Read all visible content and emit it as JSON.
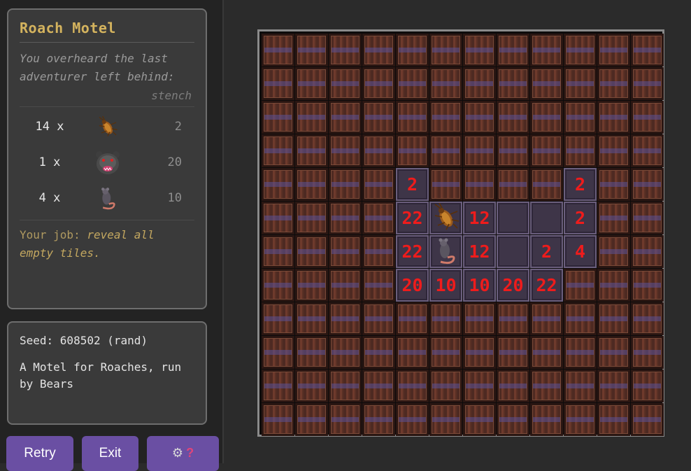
{
  "sidebar": {
    "title": "Roach Motel",
    "intro": "You overheard the last adventurer left behind:",
    "stench_header": "stench",
    "monsters": [
      {
        "count": "14 x",
        "icon": "roach-icon",
        "stench": "2"
      },
      {
        "count": "1 x",
        "icon": "bear-icon",
        "stench": "20"
      },
      {
        "count": "4 x",
        "icon": "rat-icon",
        "stench": "10"
      }
    ],
    "job_prefix": "Your job:",
    "job_emphasis": "reveal all empty tiles."
  },
  "seed_panel": {
    "seed": "Seed: 608502 (rand)",
    "description": "A Motel for Roaches, run by Bears"
  },
  "buttons": {
    "retry": "Retry",
    "exit": "Exit",
    "settings_gear": "⚙",
    "help": "?"
  },
  "colors": {
    "accent": "#d4b35e",
    "button": "#6a4fa3",
    "number": "#ee1c1c"
  },
  "board": {
    "rows": 12,
    "cols": 12,
    "revealed": [
      {
        "row": 4,
        "col": 4,
        "value": "2"
      },
      {
        "row": 4,
        "col": 9,
        "value": "2"
      },
      {
        "row": 5,
        "col": 4,
        "value": "22"
      },
      {
        "row": 5,
        "col": 5,
        "monster": "roach-icon"
      },
      {
        "row": 5,
        "col": 6,
        "value": "12"
      },
      {
        "row": 5,
        "col": 7,
        "value": ""
      },
      {
        "row": 5,
        "col": 8,
        "value": ""
      },
      {
        "row": 5,
        "col": 9,
        "value": "2"
      },
      {
        "row": 6,
        "col": 4,
        "value": "22"
      },
      {
        "row": 6,
        "col": 5,
        "monster": "rat-icon"
      },
      {
        "row": 6,
        "col": 6,
        "value": "12"
      },
      {
        "row": 6,
        "col": 7,
        "value": ""
      },
      {
        "row": 6,
        "col": 8,
        "value": "2"
      },
      {
        "row": 6,
        "col": 9,
        "value": "4"
      },
      {
        "row": 7,
        "col": 4,
        "value": "20"
      },
      {
        "row": 7,
        "col": 5,
        "value": "10"
      },
      {
        "row": 7,
        "col": 6,
        "value": "10"
      },
      {
        "row": 7,
        "col": 7,
        "value": "20"
      },
      {
        "row": 7,
        "col": 8,
        "value": "22"
      }
    ]
  }
}
